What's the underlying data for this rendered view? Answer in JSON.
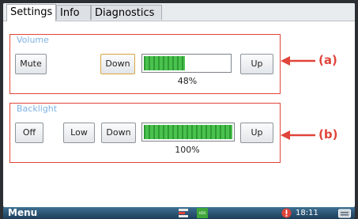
{
  "tabs": [
    {
      "label": "Settings",
      "active": true
    },
    {
      "label": "Info",
      "active": false
    },
    {
      "label": "Diagnostics",
      "active": false
    }
  ],
  "volume": {
    "title": "Volume",
    "mute_label": "Mute",
    "down_label": "Down",
    "up_label": "Up",
    "level_text": "48%",
    "level": 0.48
  },
  "backlight": {
    "title": "Backlight",
    "off_label": "Off",
    "low_label": "Low",
    "down_label": "Down",
    "up_label": "Up",
    "level_text": "100%",
    "level": 1.0
  },
  "callouts": {
    "a": "(a)",
    "b": "(b)"
  },
  "taskbar": {
    "menu_label": "Menu",
    "time": "18:11",
    "tray_badge": "HDS"
  },
  "colors": {
    "accent_red": "#e0443a",
    "bar_green": "#49c24e",
    "group_title_blue": "#7fb3e6"
  }
}
